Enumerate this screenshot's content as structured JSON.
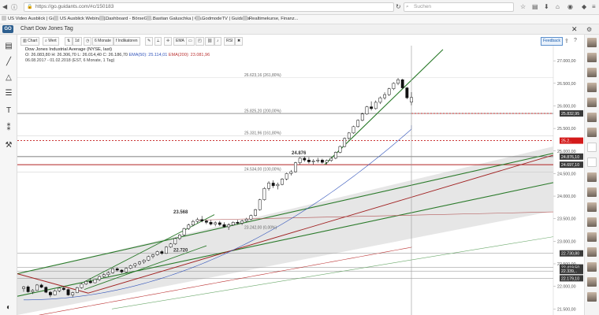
{
  "browser": {
    "url": "https://go.guidants.com/#c/150183",
    "search_placeholder": "Suchen"
  },
  "bookmarks": [
    "US Video Ausblick | Gu...",
    "US Ausblick Webinar |...",
    "Dashboard - BörseGo ...",
    "Bastian Galuschka | Gu...",
    "GodmodeTV | Guidants",
    "Realtimekurse, Finanz..."
  ],
  "app": {
    "logo": "GO",
    "title": "Chart Dow Jones Tag"
  },
  "toolbar": {
    "chart": "Chart",
    "search": "Wert",
    "timeframe": "1d",
    "period": "6 Monate",
    "indicators": "Indikatoren",
    "ema": "EMA",
    "rsi": "RSI",
    "feedback": "Feedback"
  },
  "info": {
    "name": "Dow Jones Industrial Average (NYSE, last)",
    "ohlc": "O: 26.083,80  H: 26.306,70  L: 26.014,40  C: 26.186,70",
    "ema50": "EMA(50): 25.114,01",
    "ema200": "EMA(200): 23.081,96",
    "range": "06.08.2017 - 01.02.2018  (EST, 6 Monate, 1 Tag)"
  },
  "fib_labels": [
    {
      "text": "26.623,16 (261,80%)",
      "price": 26623
    },
    {
      "text": "25.825,20 (200,00%)",
      "price": 25825
    },
    {
      "text": "25.331,96 (161,80%)",
      "price": 25332
    },
    {
      "text": "24.534,00 (100,00%)",
      "price": 24534
    },
    {
      "text": "23.242,00 (0,00%)",
      "price": 23242
    }
  ],
  "swing_labels": [
    {
      "text": "24.876",
      "price": 24876
    },
    {
      "text": "23.568",
      "price": 23568
    },
    {
      "text": "22.720",
      "price": 22720
    }
  ],
  "axis_ticks": [
    "27.000,00",
    "26.500,00",
    "26.000,00",
    "25.500,00",
    "25.000,00",
    "24.500,00",
    "24.000,00",
    "23.500,00",
    "23.000,00",
    "22.500,00",
    "22.000,00",
    "21.500,00"
  ],
  "price_tags": [
    {
      "text": "25.832,95",
      "price": 25833,
      "color": "#3a3a3a"
    },
    {
      "text": "25.2..",
      "price": 25230,
      "color": "#d41a1a"
    },
    {
      "text": "24.876,10",
      "price": 24876,
      "color": "#3a3a3a"
    },
    {
      "text": "24.697,10",
      "price": 24697,
      "color": "#3a3a3a"
    },
    {
      "text": "22.730,80",
      "price": 22731,
      "color": "#3a3a3a"
    },
    {
      "text": "22.419,50",
      "price": 22419,
      "color": "#3a3a3a"
    },
    {
      "text": "22.339,..",
      "price": 22339,
      "color": "#3a3a3a"
    },
    {
      "text": "22.179,10",
      "price": 22179,
      "color": "#3a3a3a"
    }
  ],
  "chart_data": {
    "type": "candlestick",
    "y_unit": "points",
    "ylim": [
      21400,
      27300
    ],
    "ohlc": [
      [
        21950,
        22010,
        21880,
        21990
      ],
      [
        21990,
        22020,
        21860,
        21880
      ],
      [
        21880,
        21940,
        21830,
        21910
      ],
      [
        21910,
        22050,
        21900,
        22030
      ],
      [
        22030,
        22060,
        21960,
        21980
      ],
      [
        21980,
        22000,
        21850,
        21870
      ],
      [
        21870,
        21900,
        21760,
        21810
      ],
      [
        21810,
        21930,
        21800,
        21900
      ],
      [
        21900,
        21980,
        21870,
        21960
      ],
      [
        21960,
        22010,
        21900,
        21930
      ],
      [
        21930,
        21950,
        21790,
        21810
      ],
      [
        21810,
        21880,
        21760,
        21860
      ],
      [
        21860,
        21990,
        21850,
        21970
      ],
      [
        21970,
        22070,
        21950,
        22050
      ],
      [
        22050,
        22130,
        22030,
        22110
      ],
      [
        22110,
        22180,
        22060,
        22080
      ],
      [
        22080,
        22160,
        22070,
        22150
      ],
      [
        22150,
        22240,
        22120,
        22220
      ],
      [
        22220,
        22290,
        22190,
        22260
      ],
      [
        22260,
        22330,
        22220,
        22300
      ],
      [
        22300,
        22410,
        22280,
        22390
      ],
      [
        22390,
        22420,
        22330,
        22360
      ],
      [
        22360,
        22380,
        22290,
        22320
      ],
      [
        22320,
        22420,
        22300,
        22400
      ],
      [
        22400,
        22480,
        22380,
        22460
      ],
      [
        22460,
        22520,
        22420,
        22500
      ],
      [
        22500,
        22560,
        22470,
        22540
      ],
      [
        22540,
        22600,
        22500,
        22580
      ],
      [
        22580,
        22680,
        22560,
        22660
      ],
      [
        22660,
        22720,
        22620,
        22700
      ],
      [
        22700,
        22790,
        22680,
        22770
      ],
      [
        22770,
        22800,
        22700,
        22730
      ],
      [
        22730,
        22890,
        22720,
        22870
      ],
      [
        22870,
        22960,
        22850,
        22940
      ],
      [
        22940,
        23080,
        22920,
        23060
      ],
      [
        23060,
        23160,
        23030,
        23140
      ],
      [
        23140,
        23300,
        23120,
        23280
      ],
      [
        23280,
        23390,
        23250,
        23360
      ],
      [
        23360,
        23470,
        23330,
        23440
      ],
      [
        23440,
        23520,
        23400,
        23480
      ],
      [
        23480,
        23560,
        23420,
        23450
      ],
      [
        23450,
        23480,
        23380,
        23420
      ],
      [
        23420,
        23470,
        23350,
        23380
      ],
      [
        23380,
        23440,
        23330,
        23410
      ],
      [
        23410,
        23450,
        23340,
        23370
      ],
      [
        23370,
        23420,
        23300,
        23320
      ],
      [
        23320,
        23400,
        23250,
        23360
      ],
      [
        23360,
        23440,
        23340,
        23420
      ],
      [
        23420,
        23470,
        23370,
        23400
      ],
      [
        23400,
        23480,
        23360,
        23450
      ],
      [
        23450,
        23520,
        23420,
        23490
      ],
      [
        23490,
        23590,
        23470,
        23570
      ],
      [
        23570,
        23720,
        23550,
        23700
      ],
      [
        23700,
        23940,
        23680,
        23920
      ],
      [
        23920,
        24200,
        23900,
        24170
      ],
      [
        24170,
        24330,
        24120,
        24290
      ],
      [
        24290,
        24350,
        24180,
        24230
      ],
      [
        24230,
        24300,
        24150,
        24260
      ],
      [
        24260,
        24400,
        24240,
        24380
      ],
      [
        24380,
        24520,
        24350,
        24500
      ],
      [
        24500,
        24580,
        24460,
        24540
      ],
      [
        24540,
        24760,
        24520,
        24740
      ],
      [
        24740,
        24860,
        24700,
        24840
      ],
      [
        24840,
        24876,
        24760,
        24800
      ],
      [
        24800,
        24860,
        24720,
        24760
      ],
      [
        24760,
        24820,
        24700,
        24780
      ],
      [
        24780,
        24850,
        24740,
        24800
      ],
      [
        24800,
        24830,
        24720,
        24750
      ],
      [
        24750,
        24810,
        24700,
        24790
      ],
      [
        24790,
        24860,
        24760,
        24840
      ],
      [
        24840,
        24990,
        24820,
        24970
      ],
      [
        24970,
        25120,
        24950,
        25100
      ],
      [
        25100,
        25300,
        25080,
        25280
      ],
      [
        25280,
        25420,
        25250,
        25400
      ],
      [
        25400,
        25560,
        25380,
        25540
      ],
      [
        25540,
        25700,
        25520,
        25680
      ],
      [
        25680,
        25850,
        25660,
        25820
      ],
      [
        25820,
        26000,
        25800,
        25980
      ],
      [
        25980,
        26100,
        25900,
        25940
      ],
      [
        25940,
        26120,
        25920,
        26080
      ],
      [
        26080,
        26210,
        26040,
        26180
      ],
      [
        26180,
        26300,
        26140,
        26250
      ],
      [
        26250,
        26400,
        26220,
        26380
      ],
      [
        26380,
        26520,
        26350,
        26500
      ],
      [
        26500,
        26620,
        26460,
        26580
      ],
      [
        26580,
        26600,
        26380,
        26400
      ],
      [
        26400,
        26420,
        26150,
        26180
      ],
      [
        26083,
        26306,
        26014,
        26186
      ]
    ]
  }
}
